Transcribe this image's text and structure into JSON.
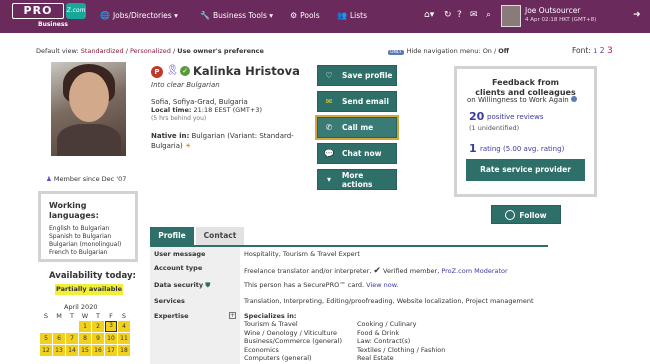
{
  "nav": {
    "logo_text": "PRO",
    "logo_badge": "Z.com",
    "logo_sub": "Business",
    "items": [
      {
        "label": "Jobs/Directories ▾",
        "icon": "globe-icon"
      },
      {
        "label": "Business Tools ▾",
        "icon": "wrench-icon"
      },
      {
        "label": "Pools",
        "icon": "pool-icon"
      },
      {
        "label": "Lists",
        "icon": "people-icon"
      }
    ],
    "user_name": "Joe Outsourcer",
    "user_time": "4 Apr 02:18 HKT (GMT+8)"
  },
  "view": {
    "prefix": "Default view:",
    "standardized": "Standardized",
    "personalized": "Personalized",
    "owner": "Use owner's preference",
    "hidenav_badge": "ONLY",
    "hidenav_text": "Hide navigation menu:",
    "hidenav_on": "On",
    "hidenav_off": "Off",
    "font_label": "Font:",
    "font_1": "1",
    "font_2": "2",
    "font_3": "3"
  },
  "profile": {
    "member_since": "Member since Dec '07",
    "name": "Kalinka Hristova",
    "tagline": "Into clear Bulgarian",
    "location": "Sofia, Sofiya-Grad, Bulgaria",
    "local_time_label": "Local time:",
    "local_time": "21:18 EEST (GMT+3)",
    "behind": "(5 hrs behind you)",
    "native_label": "Native in:",
    "native_value": "Bulgarian (Variant: Standard-Bulgaria)"
  },
  "actions": [
    {
      "label": "Save profile",
      "icon": "heart-icon"
    },
    {
      "label": "Send email",
      "icon": "envelope-icon"
    },
    {
      "label": "Call me",
      "icon": "phone-icon"
    },
    {
      "label": "Chat now",
      "icon": "chat-icon"
    },
    {
      "label": "More actions",
      "icon": "caret-down-icon"
    }
  ],
  "feedback": {
    "title_1": "Feedback from",
    "title_2": "clients and colleagues",
    "subtitle": "on Willingness to Work Again",
    "positive_count": "20",
    "positive_label": "positive reviews",
    "unidentified": "(1 unidentified)",
    "rating_count": "1",
    "rating_label": "rating (5.00 avg. rating)",
    "rate_button": "Rate service provider",
    "follow_button": "Follow"
  },
  "languages": {
    "title_1": "Working",
    "title_2": "languages:",
    "items": [
      "English to Bulgarian",
      "Spanish to Bulgarian",
      "Bulgarian (monolingual)",
      "French to Bulgarian"
    ]
  },
  "availability": {
    "title": "Availability today:",
    "status": "Partially available",
    "month": "April 2020",
    "days": [
      "S",
      "M",
      "T",
      "W",
      "T",
      "F",
      "S"
    ],
    "row1": [
      "1",
      "2",
      "3",
      "4"
    ],
    "row2": [
      "5",
      "6",
      "7",
      "8",
      "9",
      "10",
      "11"
    ],
    "row3": [
      "12",
      "13",
      "14",
      "15",
      "16",
      "17",
      "18"
    ]
  },
  "tabs": {
    "profile": "Profile",
    "contact": "Contact"
  },
  "details": {
    "user_message_label": "User message",
    "user_message": "Hospitality, Tourism & Travel Expert",
    "account_type_label": "Account type",
    "account_type": "Freelance translator and/or interpreter,",
    "verified": "Verified member,",
    "moderator": "ProZ.com Moderator",
    "data_security_label": "Data security",
    "data_security": "This person has a SecurePRO™ card.",
    "view_now": "View now.",
    "services_label": "Services",
    "services": "Translation, Interpreting, Editing/proofreading, Website localization, Project management",
    "expertise_label": "Expertise",
    "specializes_label": "Specializes in:",
    "spec_col1": [
      "Tourism & Travel",
      "Wine / Oenology / Viticulture",
      "Business/Commerce (general)",
      "Economics",
      "Computers (general)"
    ],
    "spec_col2": [
      "Cooking / Culinary",
      "Food & Drink",
      "Law: Contract(s)",
      "Textiles / Clothing / Fashion",
      "Real Estate"
    ]
  }
}
